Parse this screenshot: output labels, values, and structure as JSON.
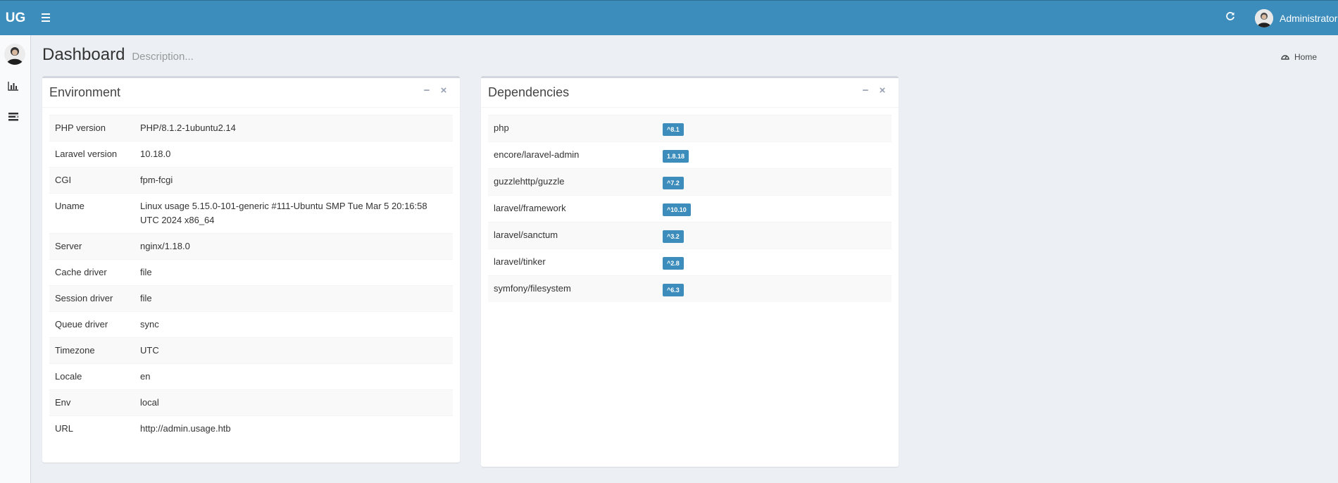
{
  "header": {
    "logo": "UG",
    "user_name": "Administrator"
  },
  "icons": {
    "menu": "hamburger-icon",
    "refresh": "refresh-icon",
    "avatar": "user-avatar",
    "sidebar_1": "bar-chart-icon",
    "sidebar_2": "list-icon",
    "breadcrumb": "dashboard-icon"
  },
  "page": {
    "title": "Dashboard",
    "description": "Description...",
    "breadcrumb_home": "Home"
  },
  "environment": {
    "title": "Environment",
    "rows": [
      {
        "key": "PHP version",
        "value": "PHP/8.1.2-1ubuntu2.14"
      },
      {
        "key": "Laravel version",
        "value": "10.18.0"
      },
      {
        "key": "CGI",
        "value": "fpm-fcgi"
      },
      {
        "key": "Uname",
        "value": "Linux usage 5.15.0-101-generic #111-Ubuntu SMP Tue Mar 5 20:16:58 UTC 2024 x86_64"
      },
      {
        "key": "Server",
        "value": "nginx/1.18.0"
      },
      {
        "key": "Cache driver",
        "value": "file"
      },
      {
        "key": "Session driver",
        "value": "file"
      },
      {
        "key": "Queue driver",
        "value": "sync"
      },
      {
        "key": "Timezone",
        "value": "UTC"
      },
      {
        "key": "Locale",
        "value": "en"
      },
      {
        "key": "Env",
        "value": "local"
      },
      {
        "key": "URL",
        "value": "http://admin.usage.htb"
      }
    ]
  },
  "dependencies": {
    "title": "Dependencies",
    "rows": [
      {
        "name": "php",
        "version": "^8.1"
      },
      {
        "name": "encore/laravel-admin",
        "version": "1.8.18"
      },
      {
        "name": "guzzlehttp/guzzle",
        "version": "^7.2"
      },
      {
        "name": "laravel/framework",
        "version": "^10.10"
      },
      {
        "name": "laravel/sanctum",
        "version": "^3.2"
      },
      {
        "name": "laravel/tinker",
        "version": "^2.8"
      },
      {
        "name": "symfony/filesystem",
        "version": "^6.3"
      }
    ]
  },
  "colors": {
    "accent": "#3c8dbc",
    "background": "#ecf0f5",
    "sidebar": "#f9fafc"
  }
}
